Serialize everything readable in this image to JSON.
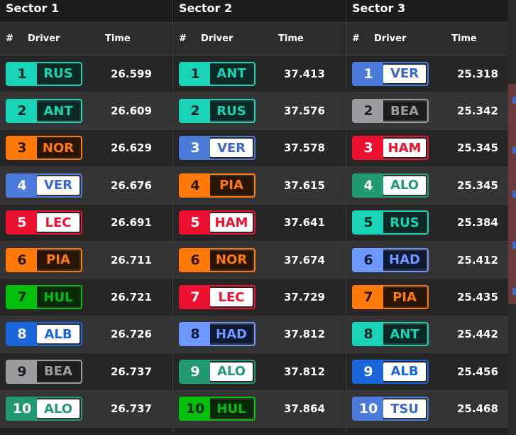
{
  "columns": {
    "num": "#",
    "driver": "Driver",
    "time": "Time"
  },
  "teams": {
    "mercedes": {
      "c": "#19d3b6",
      "ib": "#0c2a25",
      "ct": "#19d3b6",
      "pt": "#0b2a25"
    },
    "mclaren": {
      "c": "#ff7a08",
      "ib": "#2a1500",
      "ct": "#ff7a08",
      "pt": "#2a1500"
    },
    "redbull": {
      "c": "#4c7ad8",
      "ib": "#ffffff",
      "ct": "#3b66cc",
      "pt": "#ffffff"
    },
    "ferrari": {
      "c": "#ed1131",
      "ib": "#ffffff",
      "ct": "#ed1131",
      "pt": "#ffffff"
    },
    "sauber": {
      "c": "#04c00c",
      "ib": "#052a05",
      "ct": "#04c00c",
      "pt": "#052a05"
    },
    "williams": {
      "c": "#1a67db",
      "ib": "#ffffff",
      "ct": "#1a67db",
      "pt": "#ffffff"
    },
    "haas": {
      "c": "#9a9c9f",
      "ib": "#1e1e1e",
      "ct": "#9a9c9f",
      "pt": "#1e1e1e"
    },
    "aston": {
      "c": "#229971",
      "ib": "#ffffff",
      "ct": "#229971",
      "pt": "#ffffff"
    },
    "rb": {
      "c": "#6c98ff",
      "ib": "#0e1a33",
      "ct": "#6c98ff",
      "pt": "#0e1a33"
    }
  },
  "sectors": [
    {
      "title": "Sector 1",
      "rows": [
        {
          "pos": "1",
          "code": "RUS",
          "team": "mercedes",
          "time": "26.599"
        },
        {
          "pos": "2",
          "code": "ANT",
          "team": "mercedes",
          "time": "26.609"
        },
        {
          "pos": "3",
          "code": "NOR",
          "team": "mclaren",
          "time": "26.629"
        },
        {
          "pos": "4",
          "code": "VER",
          "team": "redbull",
          "time": "26.676"
        },
        {
          "pos": "5",
          "code": "LEC",
          "team": "ferrari",
          "time": "26.691"
        },
        {
          "pos": "6",
          "code": "PIA",
          "team": "mclaren",
          "time": "26.711"
        },
        {
          "pos": "7",
          "code": "HUL",
          "team": "sauber",
          "time": "26.721"
        },
        {
          "pos": "8",
          "code": "ALB",
          "team": "williams",
          "time": "26.726"
        },
        {
          "pos": "9",
          "code": "BEA",
          "team": "haas",
          "time": "26.737"
        },
        {
          "pos": "10",
          "code": "ALO",
          "team": "aston",
          "time": "26.737"
        }
      ]
    },
    {
      "title": "Sector 2",
      "rows": [
        {
          "pos": "1",
          "code": "ANT",
          "team": "mercedes",
          "time": "37.413"
        },
        {
          "pos": "2",
          "code": "RUS",
          "team": "mercedes",
          "time": "37.576"
        },
        {
          "pos": "3",
          "code": "VER",
          "team": "redbull",
          "time": "37.578"
        },
        {
          "pos": "4",
          "code": "PIA",
          "team": "mclaren",
          "time": "37.615"
        },
        {
          "pos": "5",
          "code": "HAM",
          "team": "ferrari",
          "time": "37.641"
        },
        {
          "pos": "6",
          "code": "NOR",
          "team": "mclaren",
          "time": "37.674"
        },
        {
          "pos": "7",
          "code": "LEC",
          "team": "ferrari",
          "time": "37.729"
        },
        {
          "pos": "8",
          "code": "HAD",
          "team": "rb",
          "time": "37.812"
        },
        {
          "pos": "9",
          "code": "ALO",
          "team": "aston",
          "time": "37.812"
        },
        {
          "pos": "10",
          "code": "HUL",
          "team": "sauber",
          "time": "37.864"
        }
      ]
    },
    {
      "title": "Sector 3",
      "rows": [
        {
          "pos": "1",
          "code": "VER",
          "team": "redbull",
          "time": "25.318"
        },
        {
          "pos": "2",
          "code": "BEA",
          "team": "haas",
          "time": "25.342"
        },
        {
          "pos": "3",
          "code": "HAM",
          "team": "ferrari",
          "time": "25.345"
        },
        {
          "pos": "4",
          "code": "ALO",
          "team": "aston",
          "time": "25.345"
        },
        {
          "pos": "5",
          "code": "RUS",
          "team": "mercedes",
          "time": "25.384"
        },
        {
          "pos": "6",
          "code": "HAD",
          "team": "rb",
          "time": "25.412"
        },
        {
          "pos": "7",
          "code": "PIA",
          "team": "mclaren",
          "time": "25.435"
        },
        {
          "pos": "8",
          "code": "ANT",
          "team": "mercedes",
          "time": "25.442"
        },
        {
          "pos": "9",
          "code": "ALB",
          "team": "williams",
          "time": "25.456"
        },
        {
          "pos": "10",
          "code": "TSU",
          "team": "redbull",
          "time": "25.468"
        }
      ]
    }
  ]
}
